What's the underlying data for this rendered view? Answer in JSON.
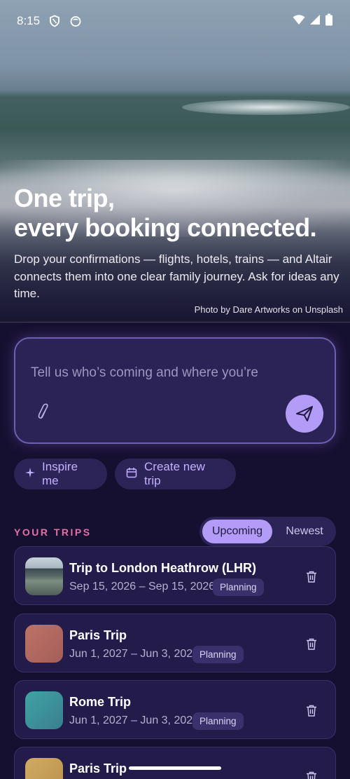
{
  "status_bar": {
    "time": "8:15"
  },
  "hero": {
    "headline_line1": "One trip,",
    "headline_line2": "every booking connected.",
    "subtext": "Drop your confirmations — flights, hotels, trains — and Altair connects them into one clear family journey. Ask for ideas any time.",
    "credit": "Photo by Dare Artworks on Unsplash"
  },
  "composer": {
    "placeholder": "Tell us who’s coming and where you’re"
  },
  "actions": {
    "inspire_label": "Inspire me",
    "create_label": "Create new trip"
  },
  "trips": {
    "section_label": "YOUR TRIPS",
    "sort_options": [
      "Upcoming",
      "Newest"
    ],
    "sort_selected": "Upcoming",
    "items": [
      {
        "title": "Trip to London Heathrow (LHR)",
        "dates": "Sep 15, 2026 – Sep 15, 2026",
        "status": "Planning",
        "thumb": "airport-photo"
      },
      {
        "title": "Paris Trip",
        "dates": "Jun 1, 2027 – Jun 3, 2027",
        "status": "Planning",
        "thumb_color": "#b0675f"
      },
      {
        "title": "Rome Trip",
        "dates": "Jun 1, 2027 – Jun 3, 2027",
        "status": "Planning",
        "thumb_color": "#3c9296"
      },
      {
        "title": "Paris Trip",
        "dates": "",
        "status": "",
        "thumb_color": "#c9a159"
      }
    ]
  },
  "colors": {
    "accent": "#b39cf7",
    "background": "#161030",
    "trips_label": "#e46fa7"
  }
}
